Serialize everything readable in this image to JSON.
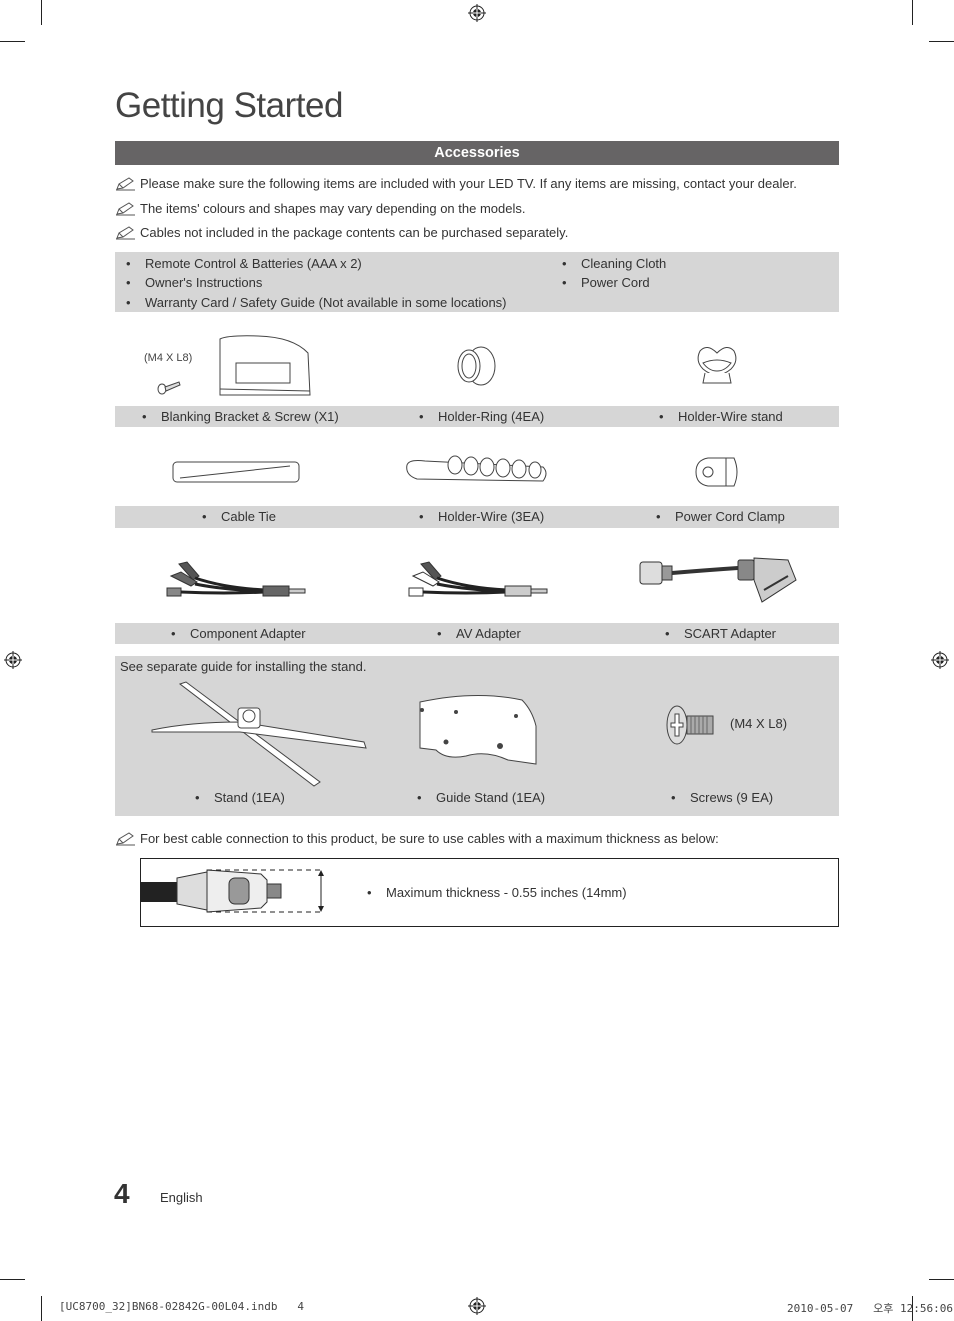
{
  "page": {
    "title": "Getting Started",
    "section": "Accessories",
    "notes": [
      "Please make sure the following items are included with your LED TV. If any items are missing, contact your dealer.",
      "The items' colours and shapes may vary depending on the models.",
      "Cables not included in the package contents can be purchased separately."
    ],
    "included_items": {
      "left": [
        "Remote Control & Batteries (AAA x 2)",
        "Owner's Instructions",
        "Warranty Card / Safety Guide (Not available in some locations)"
      ],
      "right": [
        "Cleaning Cloth",
        "Power Cord"
      ]
    },
    "accessory_rows": [
      {
        "items": [
          {
            "label": "Blanking Bracket & Screw (X1)",
            "spec": "(M4 X L8)",
            "icon": "blanking-bracket-icon"
          },
          {
            "label": "Holder-Ring (4EA)",
            "icon": "holder-ring-icon"
          },
          {
            "label": "Holder-Wire stand",
            "icon": "holder-wire-stand-icon"
          }
        ]
      },
      {
        "items": [
          {
            "label": "Cable Tie",
            "icon": "cable-tie-icon"
          },
          {
            "label": "Holder-Wire (3EA)",
            "icon": "holder-wire-icon"
          },
          {
            "label": "Power Cord Clamp",
            "icon": "power-cord-clamp-icon"
          }
        ]
      },
      {
        "items": [
          {
            "label": "Component Adapter",
            "icon": "component-adapter-icon"
          },
          {
            "label": "AV Adapter",
            "icon": "av-adapter-icon"
          },
          {
            "label": "SCART Adapter",
            "icon": "scart-adapter-icon"
          }
        ]
      }
    ],
    "stand_box": {
      "caption": "See separate guide for installing the stand.",
      "items": [
        {
          "label": "Stand (1EA)",
          "icon": "stand-icon"
        },
        {
          "label": "Guide Stand (1EA)",
          "icon": "guide-stand-icon"
        },
        {
          "label": "Screws (9 EA)",
          "spec": "(M4 X L8)",
          "icon": "screw-icon"
        }
      ]
    },
    "cable_note": "For best cable connection to this product, be sure to use cables with a maximum thickness as below:",
    "cable_spec": "Maximum thickness - 0.55 inches (14mm)",
    "footer": {
      "page_number": "4",
      "language": "English",
      "slug_file": "[UC8700_32]BN68-02842G-00L04.indb   4",
      "slug_date": "2010-05-07   오후 12:56:06"
    },
    "colors": {
      "section_bar": "#666465",
      "box_gray": "#d6d6d6",
      "text": "#333333"
    }
  }
}
